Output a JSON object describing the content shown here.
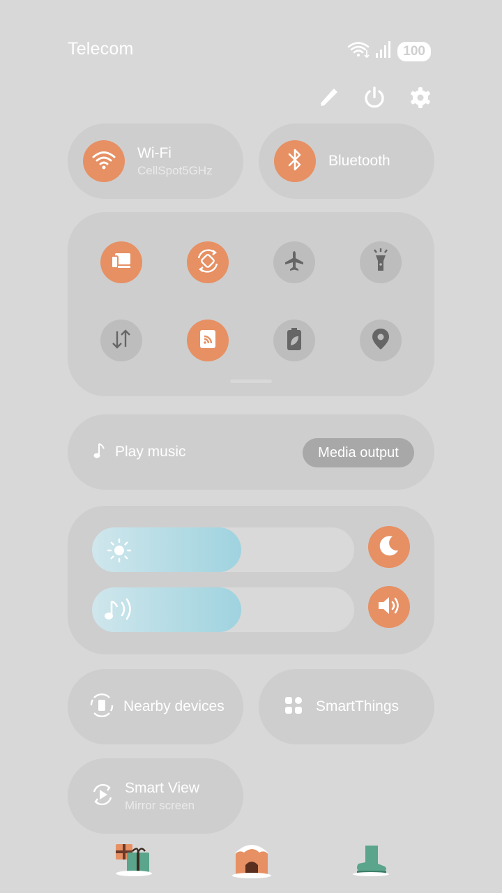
{
  "status_bar": {
    "carrier": "Telecom",
    "battery": "100",
    "wifi_icon": "wifi-data-icon",
    "signal_icon": "signal-bars-icon"
  },
  "top_actions": [
    {
      "name": "edit-icon"
    },
    {
      "name": "power-icon"
    },
    {
      "name": "settings-gear-icon"
    }
  ],
  "wifi": {
    "title": "Wi-Fi",
    "subtitle": "CellSpot5GHz",
    "state": "on"
  },
  "bluetooth": {
    "title": "Bluetooth",
    "state": "on"
  },
  "quick_toggles": [
    {
      "icon": "screen-mirroring-icon",
      "state": "on"
    },
    {
      "icon": "auto-rotate-icon",
      "state": "on"
    },
    {
      "icon": "airplane-icon",
      "state": "off"
    },
    {
      "icon": "flashlight-icon",
      "state": "off"
    },
    {
      "icon": "mobile-data-icon",
      "state": "off"
    },
    {
      "icon": "nfc-icon",
      "state": "on"
    },
    {
      "icon": "power-saving-icon",
      "state": "off"
    },
    {
      "icon": "location-icon",
      "state": "off"
    }
  ],
  "media": {
    "title": "Play music",
    "output_label": "Media output"
  },
  "brightness": {
    "level": 0.57,
    "icon": "sun-icon",
    "night_mode_icon": "moon-icon"
  },
  "volume": {
    "level": 0.57,
    "icon": "music-volume-icon",
    "sound_mode_icon": "speaker-icon"
  },
  "nearby_devices": {
    "title": "Nearby devices"
  },
  "smart_things": {
    "title": "SmartThings"
  },
  "smart_view": {
    "title": "Smart View",
    "subtitle": "Mirror screen"
  },
  "colors": {
    "accent": "#e69064",
    "off": "#bdbdbd",
    "panel": "#cecece",
    "background": "#d8d8d8",
    "slider": "#9fd3df"
  }
}
